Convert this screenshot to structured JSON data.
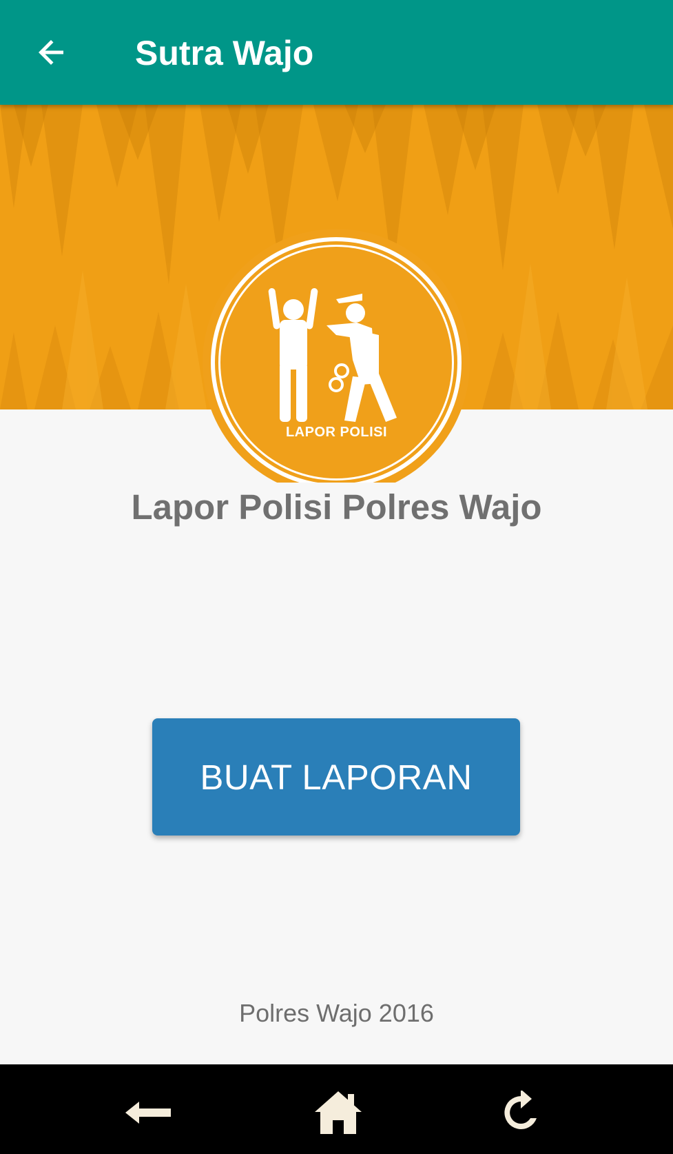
{
  "appbar": {
    "title": "Sutra Wajo",
    "back_icon": "arrow-left-icon",
    "color": "#009688"
  },
  "banner": {
    "color": "#f09f15"
  },
  "logo": {
    "label": "LAPOR POLISI",
    "icon": "police-arrest-icon",
    "color": "#f0a01a"
  },
  "main": {
    "headline": "Lapor Polisi Polres Wajo",
    "button_label": "BUAT LAPORAN",
    "button_color": "#2a7fb8"
  },
  "footer": {
    "text": "Polres Wajo 2016"
  },
  "navbar": {
    "items": [
      {
        "icon": "back-arrow-icon"
      },
      {
        "icon": "home-icon"
      },
      {
        "icon": "refresh-icon"
      }
    ]
  }
}
